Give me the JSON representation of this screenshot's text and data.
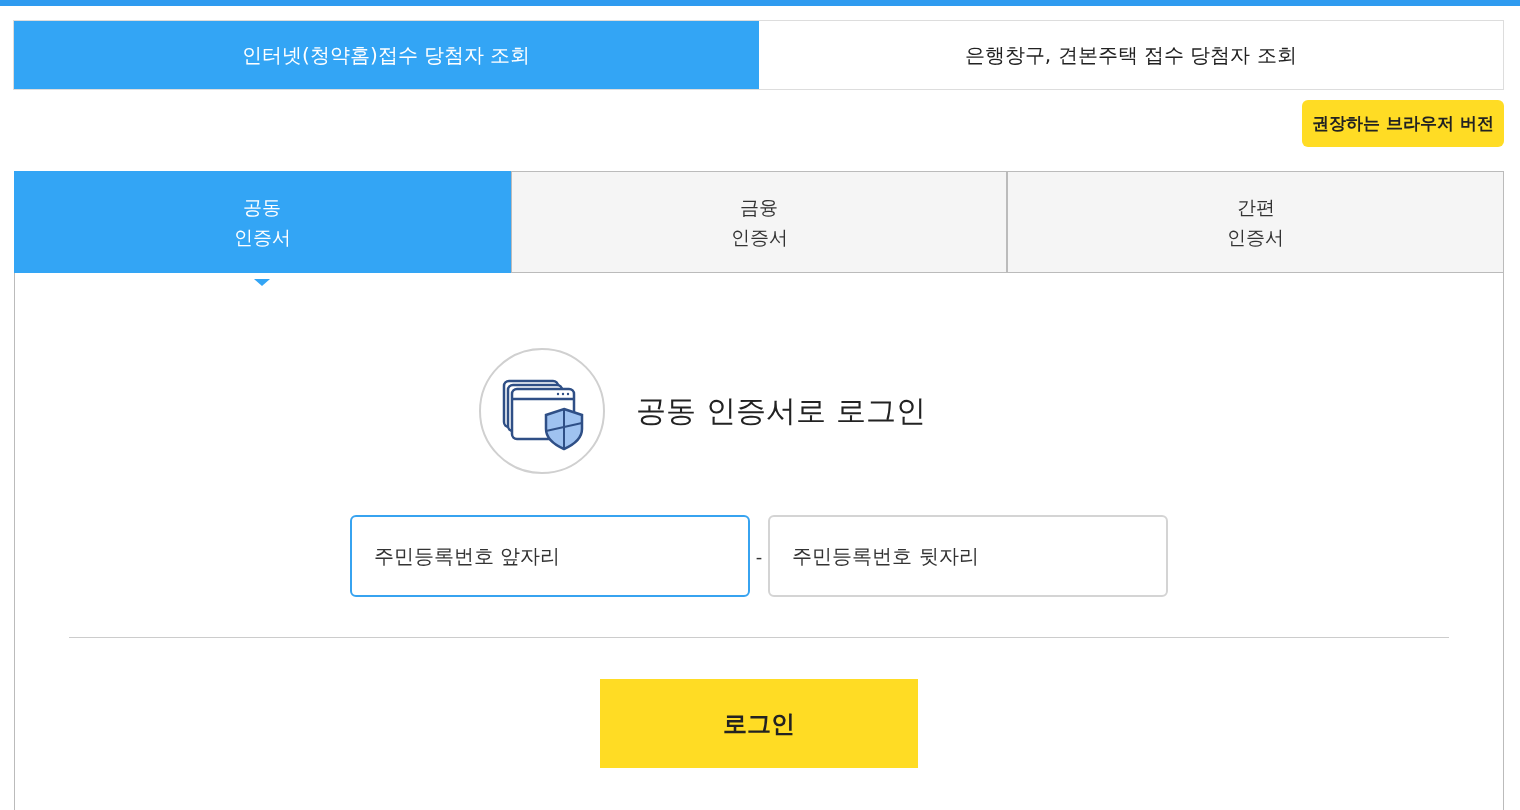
{
  "top_tabs": [
    {
      "label": "인터넷(청약홈)접수 당첨자 조회",
      "selected": true
    },
    {
      "label": "은행창구, 견본주택 접수 당첨자 조회",
      "selected": false
    }
  ],
  "browser_button": "권장하는 브라우저 버전",
  "cert_tabs": [
    {
      "label": "공동\n인증서",
      "selected": true
    },
    {
      "label": "금융\n인증서",
      "selected": false
    },
    {
      "label": "간편\n인증서",
      "selected": false
    }
  ],
  "login": {
    "title": "공동 인증서로 로그인",
    "fields": [
      {
        "placeholder": "주민등록번호 앞자리",
        "focused": true
      },
      {
        "placeholder": "주민등록번호 뒷자리",
        "focused": false
      }
    ],
    "separator": "-",
    "button": "로그인"
  }
}
